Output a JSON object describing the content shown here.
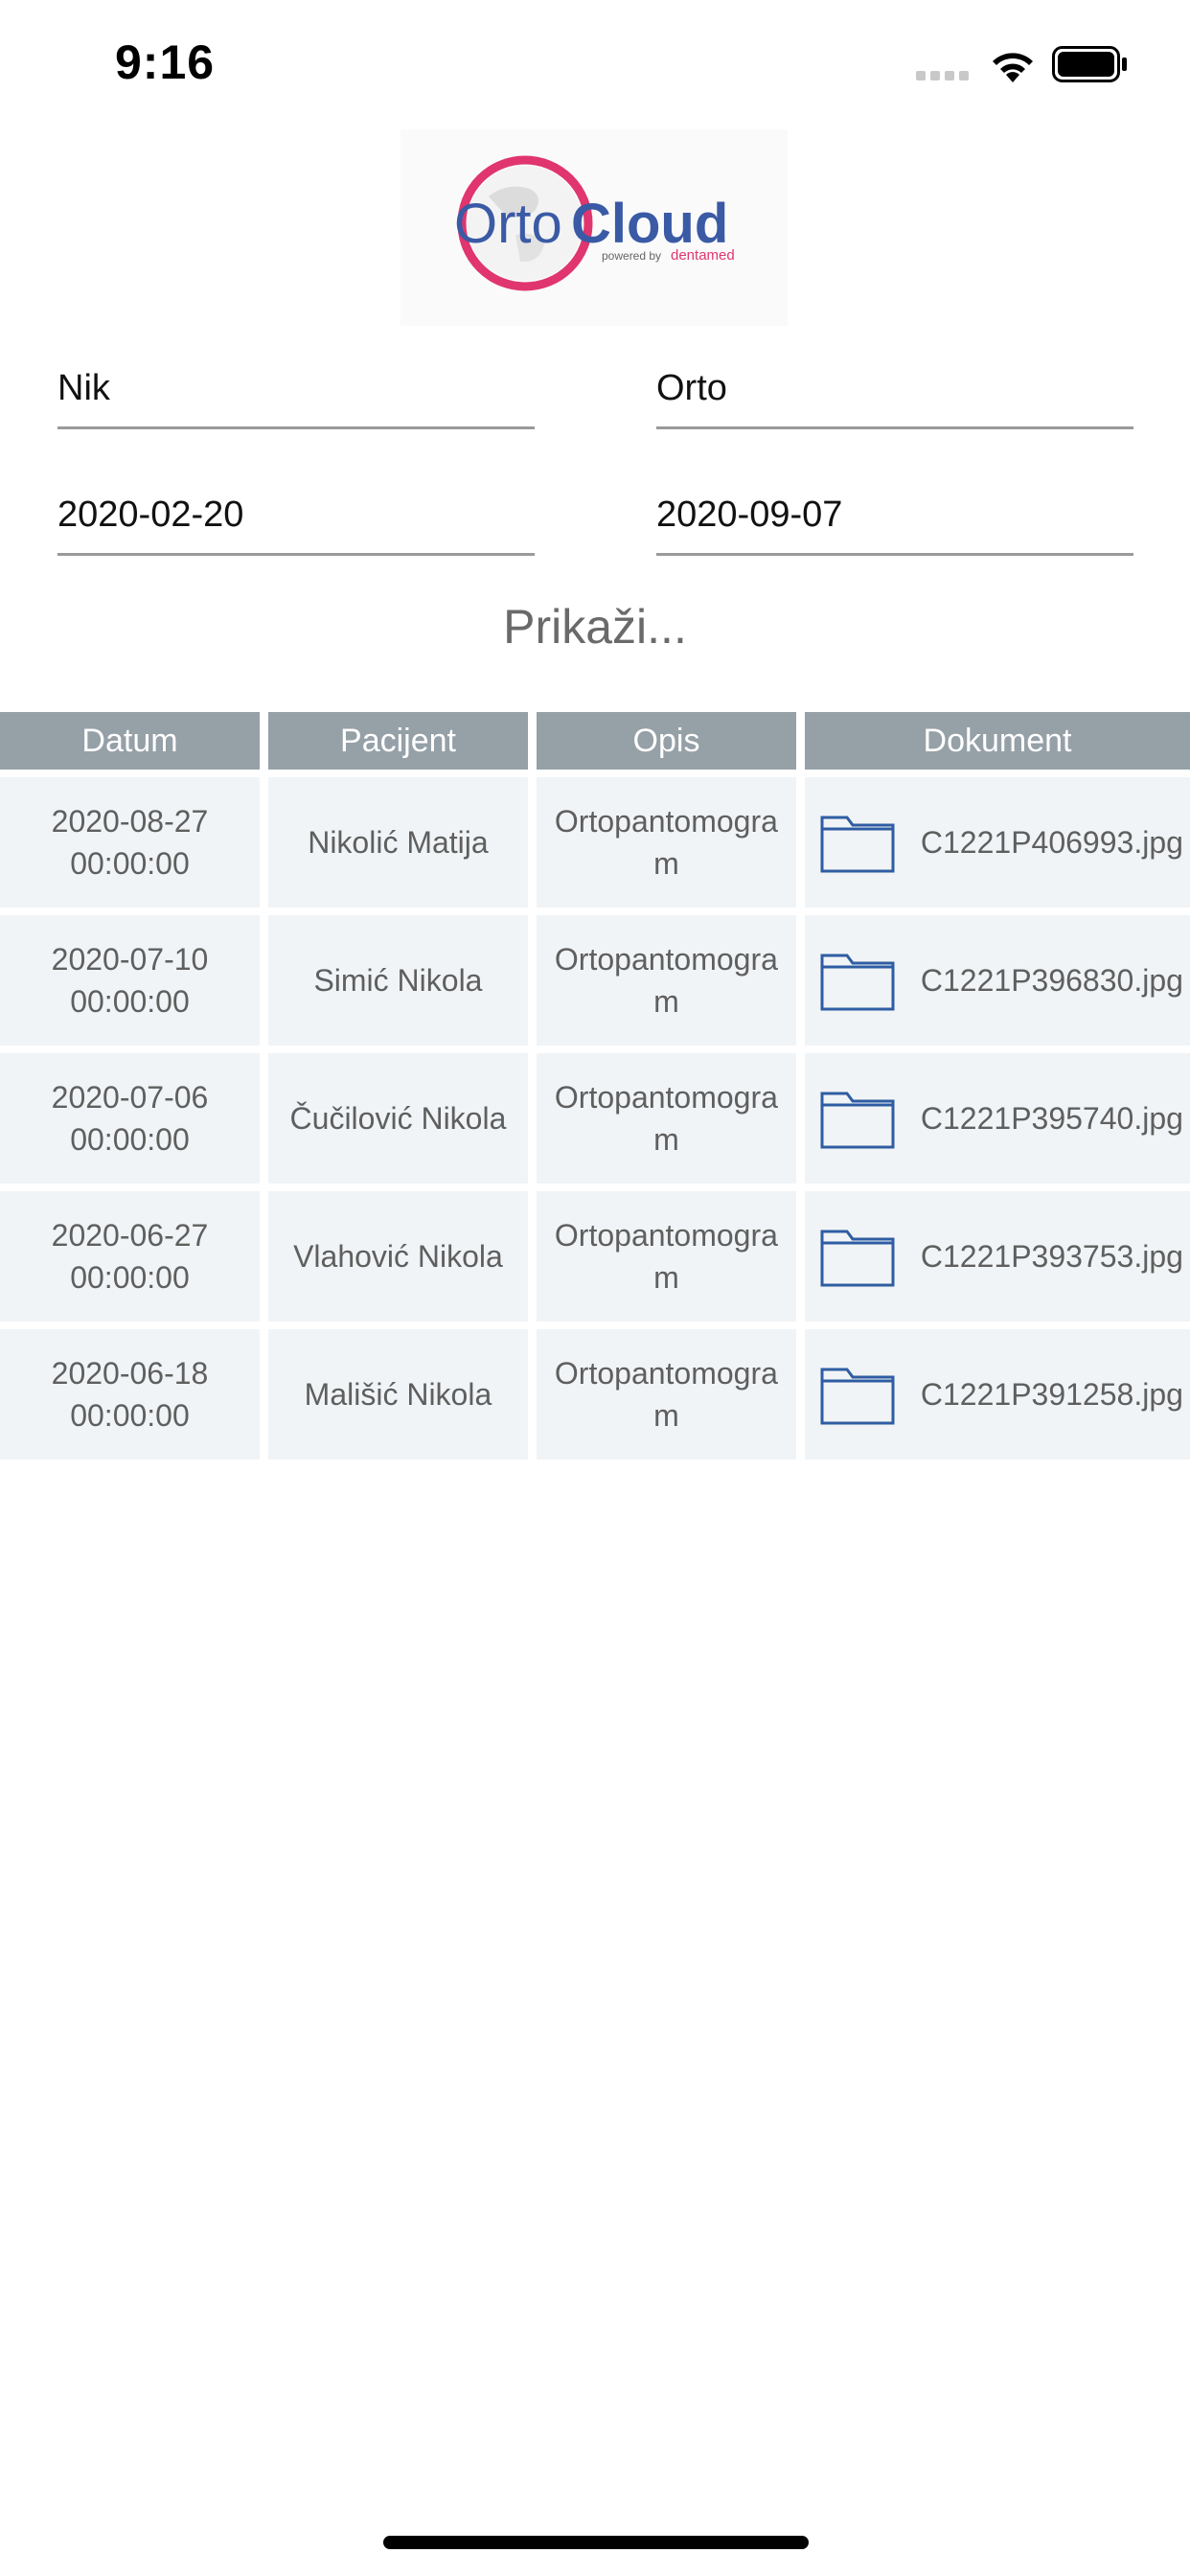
{
  "status_bar": {
    "time": "9:16"
  },
  "logo": {
    "brand_left": "Orto",
    "brand_right": "Cloud",
    "powered_by": "powered by",
    "partner": "dentamed"
  },
  "filters": {
    "name": "Nik",
    "type": "Orto",
    "date_from": "2020-02-20",
    "date_to": "2020-09-07",
    "show_label": "Prikaži..."
  },
  "table": {
    "headers": [
      "Datum",
      "Pacijent",
      "Opis",
      "Dokument"
    ],
    "rows": [
      {
        "date": "2020-08-27",
        "time": "00:00:00",
        "patient": "Nikolić Matija",
        "description": "Ortopantomogram",
        "document": "C1221P406993.jpg"
      },
      {
        "date": "2020-07-10",
        "time": "00:00:00",
        "patient": "Simić Nikola",
        "description": "Ortopantomogram",
        "document": "C1221P396830.jpg"
      },
      {
        "date": "2020-07-06",
        "time": "00:00:00",
        "patient": "Čučilović Nikola",
        "description": "Ortopantomogram",
        "document": "C1221P395740.jpg"
      },
      {
        "date": "2020-06-27",
        "time": "00:00:00",
        "patient": "Vlahović Nikola",
        "description": "Ortopantomogram",
        "document": "C1221P393753.jpg"
      },
      {
        "date": "2020-06-18",
        "time": "00:00:00",
        "patient": "Mališić Nikola",
        "description": "Ortopantomogram",
        "document": "C1221P391258.jpg"
      }
    ]
  },
  "colors": {
    "header_bg": "#95a0a7",
    "row_bg": "#f1f4f6",
    "logo_pink": "#e0356e",
    "logo_blue": "#3a5aa5"
  }
}
